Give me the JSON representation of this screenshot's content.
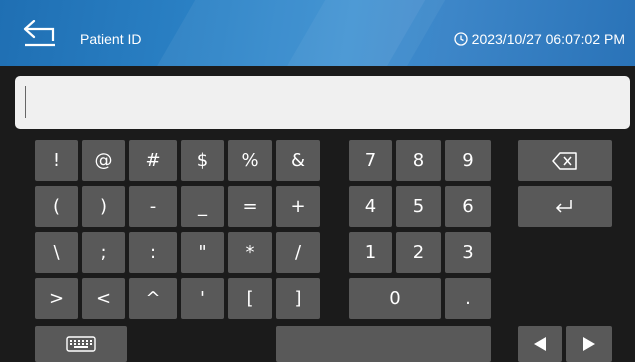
{
  "header": {
    "title": "Patient ID",
    "datetime": "2023/10/27 06:07:02 PM",
    "back_icon": "back-arrow-icon",
    "clock_icon": "clock-icon"
  },
  "input": {
    "value": ""
  },
  "keyboard": {
    "symbols_row1": [
      "!",
      "@",
      "#",
      "$",
      "%",
      "&"
    ],
    "symbols_row2": [
      "(",
      ")",
      "-",
      "_",
      "=",
      "+"
    ],
    "symbols_row3": [
      "\\",
      ";",
      ":",
      "\"",
      "*",
      "/"
    ],
    "symbols_row4": [
      ">",
      "<",
      "^",
      "'",
      "[",
      "]"
    ],
    "numpad_row1": [
      "7",
      "8",
      "9"
    ],
    "numpad_row2": [
      "4",
      "5",
      "6"
    ],
    "numpad_row3": [
      "1",
      "2",
      "3"
    ],
    "zero": "0",
    "dot": ".",
    "backspace_icon": "backspace-icon",
    "enter_icon": "enter-icon",
    "keyboard_toggle_icon": "keyboard-icon",
    "left_arrow_icon": "arrow-left-icon",
    "right_arrow_icon": "arrow-right-icon"
  },
  "colors": {
    "header_blue": "#2c83c7",
    "key": "#595959",
    "background": "#1b1b1b",
    "input_bg": "#f0f0f0"
  }
}
